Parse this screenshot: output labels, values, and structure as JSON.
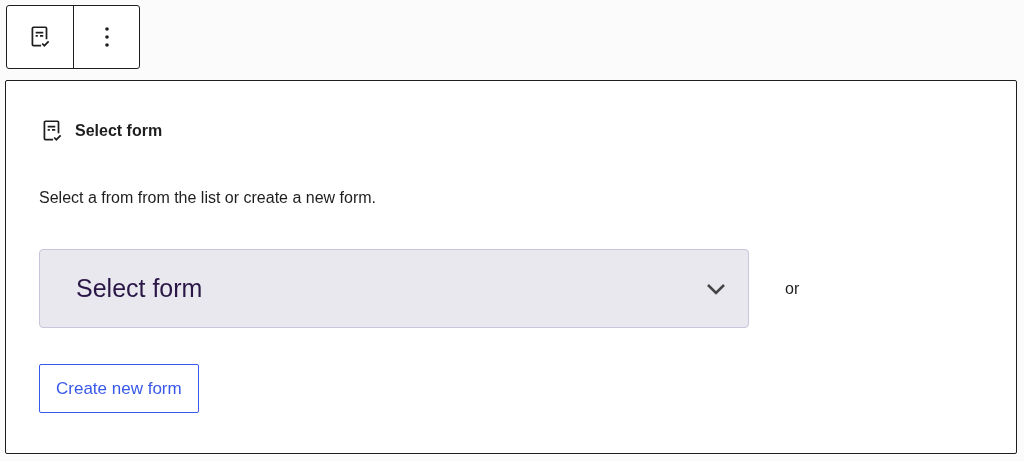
{
  "toolbar": {
    "buttons": [
      {
        "kind": "form"
      },
      {
        "kind": "more"
      }
    ]
  },
  "panel": {
    "title": "Select form",
    "description": "Select a from from the list or create a new form.",
    "select": {
      "placeholder": "Select form"
    },
    "separator": "or",
    "button": "Create new form"
  }
}
